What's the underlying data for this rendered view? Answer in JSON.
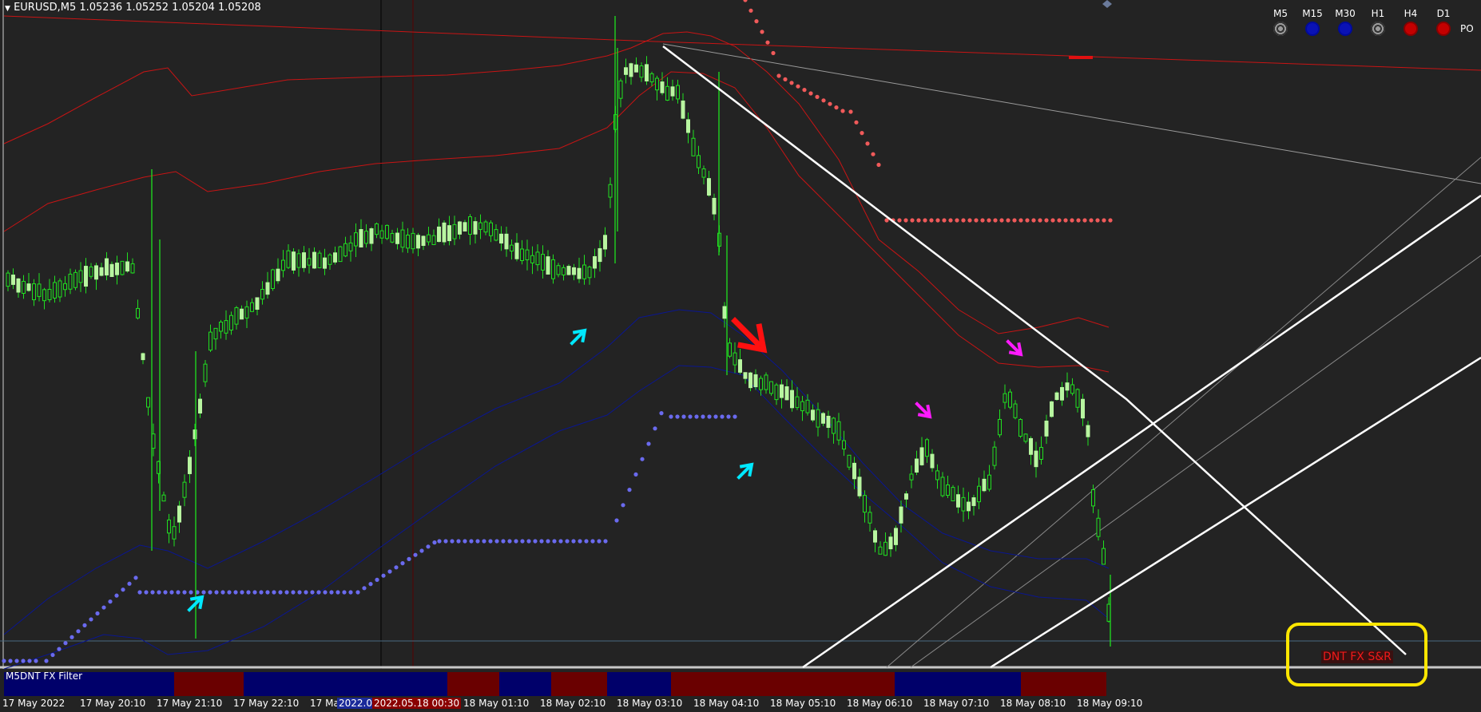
{
  "chart_title": "EURUSD,M5  1.05236 1.05252 1.05204 1.05208",
  "timeframes": [
    {
      "label": "M5",
      "state": "grey"
    },
    {
      "label": "M15",
      "state": "blue"
    },
    {
      "label": "M30",
      "state": "blue"
    },
    {
      "label": "H1",
      "state": "grey"
    },
    {
      "label": "H4",
      "state": "red"
    },
    {
      "label": "D1",
      "state": "red"
    }
  ],
  "po_label": "PO",
  "indicator_label": "M5DNT FX Filter",
  "sr_label": "DNT FX S&R",
  "time_axis": [
    "17 May 2022",
    "17 May 20:10",
    "17 May 21:10",
    "17 May 22:10",
    "17 Ma",
    "18 May 01:10",
    "18 May 02:10",
    "18 May 03:10",
    "18 May 04:10",
    "18 May 05:10",
    "18 May 06:10",
    "18 May 07:10",
    "18 May 08:10",
    "18 May 09:10"
  ],
  "crosshair_times": [
    "2022.0",
    "2022.05.18 00:30"
  ],
  "colors": {
    "background": "#232323",
    "candle_bull": "#b8f5a0",
    "candle_bear": "#20e020",
    "band_red": "#c81414",
    "band_blue": "#0a1690",
    "dots_blue": "#6a6aee",
    "dots_red": "#f05a5a",
    "arrow_cyan": "#00e8ff",
    "arrow_magenta": "#ff1aff",
    "arrow_red": "#ff1010",
    "trend_white": "#ffffff",
    "filter_blue": "#00006a",
    "filter_red": "#6a0000",
    "highlight_yellow": "#ffe600"
  },
  "filter_segments": [
    "blue",
    "red",
    "blue",
    "red",
    "blue",
    "red",
    "blue",
    "red",
    "blue",
    "red"
  ]
}
